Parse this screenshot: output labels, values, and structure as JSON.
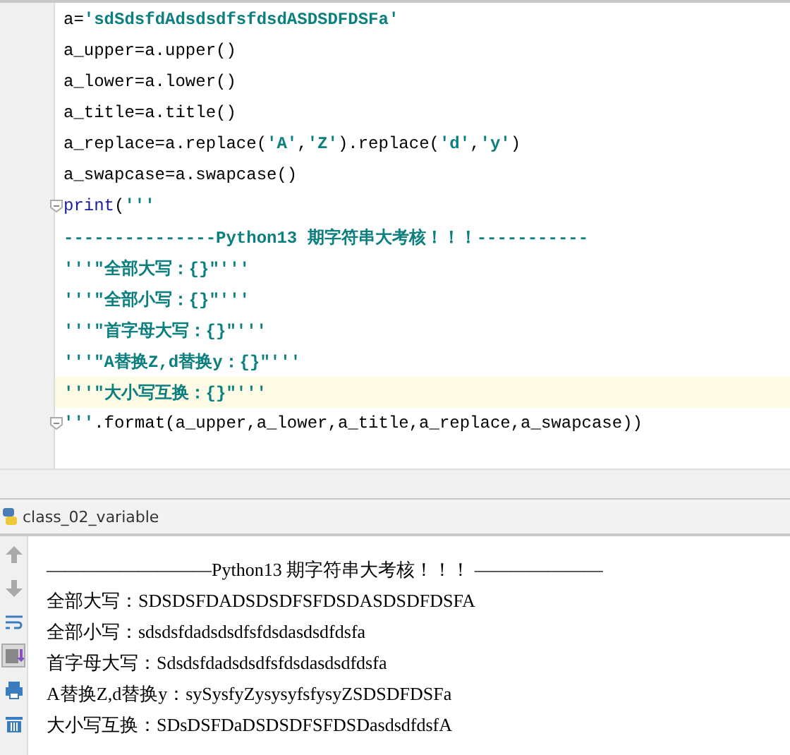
{
  "editor": {
    "lines": [
      {
        "current": false,
        "fold": false,
        "segments": [
          {
            "kind": "plain",
            "text": "a="
          },
          {
            "kind": "string",
            "text": "'sdSdsfdAdsdsdfsfdsdASDSDFDSFa'"
          }
        ]
      },
      {
        "current": false,
        "fold": false,
        "segments": [
          {
            "kind": "plain",
            "text": "a_upper=a.upper()"
          }
        ]
      },
      {
        "current": false,
        "fold": false,
        "segments": [
          {
            "kind": "plain",
            "text": "a_lower=a.lower()"
          }
        ]
      },
      {
        "current": false,
        "fold": false,
        "segments": [
          {
            "kind": "plain",
            "text": "a_title=a.title()"
          }
        ]
      },
      {
        "current": false,
        "fold": false,
        "segments": [
          {
            "kind": "plain",
            "text": "a_replace=a.replace("
          },
          {
            "kind": "string",
            "text": "'A'"
          },
          {
            "kind": "plain",
            "text": ","
          },
          {
            "kind": "string",
            "text": "'Z'"
          },
          {
            "kind": "plain",
            "text": ").replace("
          },
          {
            "kind": "string",
            "text": "'d'"
          },
          {
            "kind": "plain",
            "text": ","
          },
          {
            "kind": "string",
            "text": "'y'"
          },
          {
            "kind": "plain",
            "text": ")"
          }
        ]
      },
      {
        "current": false,
        "fold": false,
        "segments": [
          {
            "kind": "plain",
            "text": "a_swapcase=a.swapcase()"
          }
        ]
      },
      {
        "current": false,
        "fold": true,
        "segments": [
          {
            "kind": "keyword",
            "text": "print"
          },
          {
            "kind": "plain",
            "text": "("
          },
          {
            "kind": "string",
            "text": "'''"
          }
        ]
      },
      {
        "current": false,
        "fold": false,
        "segments": [
          {
            "kind": "string",
            "text": "---------------Python13 期字符串大考核！！！-----------"
          }
        ]
      },
      {
        "current": false,
        "fold": false,
        "segments": [
          {
            "kind": "string",
            "text": "'''\"全部大写：{}\"'''"
          }
        ]
      },
      {
        "current": false,
        "fold": false,
        "segments": [
          {
            "kind": "string",
            "text": "'''\"全部小写：{}\"'''"
          }
        ]
      },
      {
        "current": false,
        "fold": false,
        "segments": [
          {
            "kind": "string",
            "text": "'''\"首字母大写：{}\"'''"
          }
        ]
      },
      {
        "current": false,
        "fold": false,
        "segments": [
          {
            "kind": "string",
            "text": "'''\"A替换Z,d替换y：{}\"'''"
          }
        ]
      },
      {
        "current": true,
        "fold": false,
        "segments": [
          {
            "kind": "string",
            "text": "'''\"大小写互换：{}\"'''"
          }
        ]
      },
      {
        "current": false,
        "fold": true,
        "segments": [
          {
            "kind": "string",
            "text": "'''"
          },
          {
            "kind": "plain",
            "text": ".format(a_upper,a_lower,a_title,a_replace,a_swapcase))"
          }
        ]
      }
    ]
  },
  "run_panel": {
    "tab": "class_02_variable",
    "toolbar": [
      {
        "kind": "up",
        "selected": false
      },
      {
        "kind": "down",
        "selected": false
      },
      {
        "kind": "wrap",
        "selected": false
      },
      {
        "kind": "scroll-end",
        "selected": true
      },
      {
        "kind": "print",
        "selected": false
      },
      {
        "kind": "trash",
        "selected": false
      }
    ],
    "output": [
      "—————————Python13 期字符串大考核！！！ ———————",
      "全部大写：SDSDSFDADSDSDFSFDSDASDSDFDSFA",
      "全部小写：sdsdsfdadsdsdfsfdsdasdsdfdsfa",
      "首字母大写：Sdsdsfdadsdsdfsfdsdasdsdfdsfa",
      "A替换Z,d替换y：sySysfyZysysyfsfysyZSDSDFDSFa",
      "大小写互换：SDsDSFDaDSDSDFSFDSDasdsdfdsfA"
    ]
  }
}
